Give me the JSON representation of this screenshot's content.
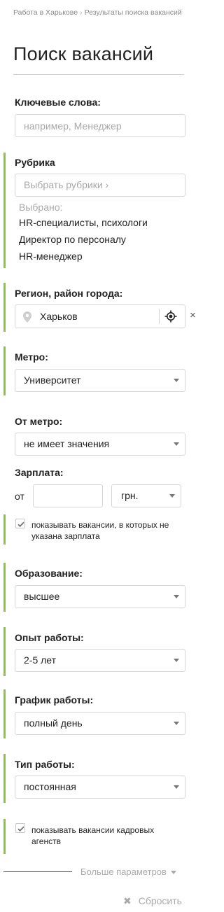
{
  "breadcrumb": {
    "items": [
      "Работа в Харькове",
      "Результаты поиска вакансий"
    ],
    "separator": "›"
  },
  "page_title": "Поиск вакансий",
  "keywords": {
    "label": "Ключевые слова:",
    "placeholder": "например, Менеджер",
    "value": ""
  },
  "rubric": {
    "label": "Рубрика",
    "picker_text": "Выбрать рубрики ›",
    "selected_title": "Выбрано:",
    "selected": [
      "HR-специалисты, психологи",
      "Директор по персоналу",
      "HR-менеджер"
    ]
  },
  "region": {
    "label": "Регион, район города:",
    "value": "Харьков",
    "clear": "×"
  },
  "metro": {
    "label": "Метро:",
    "value": "Университет"
  },
  "from_metro": {
    "label": "От метро:",
    "value": "не имеет значения"
  },
  "salary": {
    "label": "Зарплата:",
    "from_label": "от",
    "from_value": "",
    "currency": "грн.",
    "show_unspecified": {
      "checked": true,
      "text": "показывать вакансии, в которых не указана зарплата"
    }
  },
  "education": {
    "label": "Образование:",
    "value": "высшее"
  },
  "experience": {
    "label": "Опыт работы:",
    "value": "2-5 лет"
  },
  "schedule": {
    "label": "График работы:",
    "value": "полный день"
  },
  "job_type": {
    "label": "Тип работы:",
    "value": "постоянная"
  },
  "agencies": {
    "checked": true,
    "text": "показывать вакансии кадровых агенств"
  },
  "more_params": "Больше параметров",
  "reset": "Сбросить",
  "colors": {
    "accent_bar": "#8cc63f",
    "text": "#222222",
    "muted": "#a8a8a8",
    "border": "#d6d6d6"
  }
}
